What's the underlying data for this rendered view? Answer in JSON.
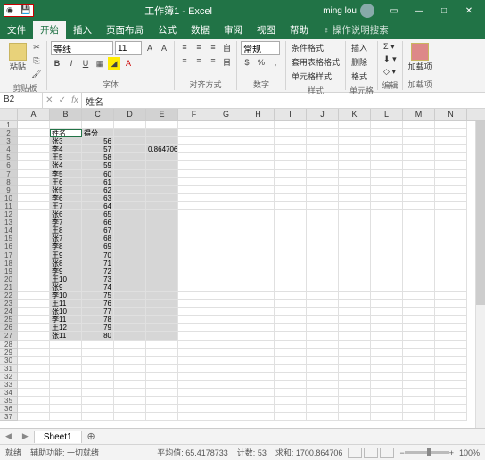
{
  "titlebar": {
    "title": "工作簿1 - Excel",
    "user": "ming lou"
  },
  "tabs": [
    "文件",
    "开始",
    "插入",
    "页面布局",
    "公式",
    "数据",
    "审阅",
    "视图",
    "帮助"
  ],
  "tell_me": "操作说明搜索",
  "active_tab": 1,
  "ribbon": {
    "clipboard": {
      "paste": "粘贴",
      "label": "剪贴板"
    },
    "font": {
      "name": "等线",
      "size": "11",
      "label": "字体"
    },
    "align": {
      "wrap": "自动换行",
      "merge": "合并后居中",
      "label": "对齐方式",
      "wrap_short": "自",
      "merge_short": "目"
    },
    "number": {
      "format": "常规",
      "label": "数字"
    },
    "styles": {
      "cond": "条件格式",
      "table": "套用表格格式",
      "cell": "单元格样式",
      "label": "样式"
    },
    "cells": {
      "insert": "插入",
      "delete": "删除",
      "format": "格式",
      "label": "单元格"
    },
    "editing": {
      "sum": "Σ",
      "fill": "填",
      "clear": "清",
      "label": "编辑"
    },
    "addin": {
      "btn": "加载项",
      "label": "加载项"
    }
  },
  "formula_bar": {
    "name_box": "B2",
    "fx_value": "姓名"
  },
  "columns": [
    "A",
    "B",
    "C",
    "D",
    "E",
    "F",
    "G",
    "H",
    "I",
    "J",
    "K",
    "L",
    "M",
    "N"
  ],
  "sel_cols": [
    "B",
    "C",
    "D",
    "E"
  ],
  "row_count": 37,
  "sel_row_start": 2,
  "sel_row_end": 27,
  "data": {
    "header": {
      "B": "姓名",
      "C": "得分"
    },
    "rows": [
      {
        "B": "张3",
        "C": 56
      },
      {
        "B": "李4",
        "C": 57
      },
      {
        "B": "王5",
        "C": 58
      },
      {
        "B": "张4",
        "C": 59
      },
      {
        "B": "李5",
        "C": 60
      },
      {
        "B": "王6",
        "C": 61
      },
      {
        "B": "张5",
        "C": 62
      },
      {
        "B": "李6",
        "C": 63
      },
      {
        "B": "王7",
        "C": 64
      },
      {
        "B": "张6",
        "C": 65
      },
      {
        "B": "李7",
        "C": 66
      },
      {
        "B": "王8",
        "C": 67
      },
      {
        "B": "张7",
        "C": 68
      },
      {
        "B": "李8",
        "C": 69
      },
      {
        "B": "王9",
        "C": 70
      },
      {
        "B": "张8",
        "C": 71
      },
      {
        "B": "李9",
        "C": 72
      },
      {
        "B": "王10",
        "C": 73
      },
      {
        "B": "张9",
        "C": 74
      },
      {
        "B": "李10",
        "C": 75
      },
      {
        "B": "王11",
        "C": 76
      },
      {
        "B": "张10",
        "C": 77
      },
      {
        "B": "李11",
        "C": 78
      },
      {
        "B": "王12",
        "C": 79
      },
      {
        "B": "张11",
        "C": 80
      }
    ],
    "e4": "0.864706"
  },
  "sheet_tabs": {
    "name": "Sheet1"
  },
  "statusbar": {
    "mode": "就绪",
    "access": "辅助功能: 一切就绪",
    "avg_label": "平均值:",
    "avg": "65.4178733",
    "count_label": "计数:",
    "count": "53",
    "sum_label": "求和:",
    "sum": "1700.864706",
    "zoom": "100%"
  }
}
